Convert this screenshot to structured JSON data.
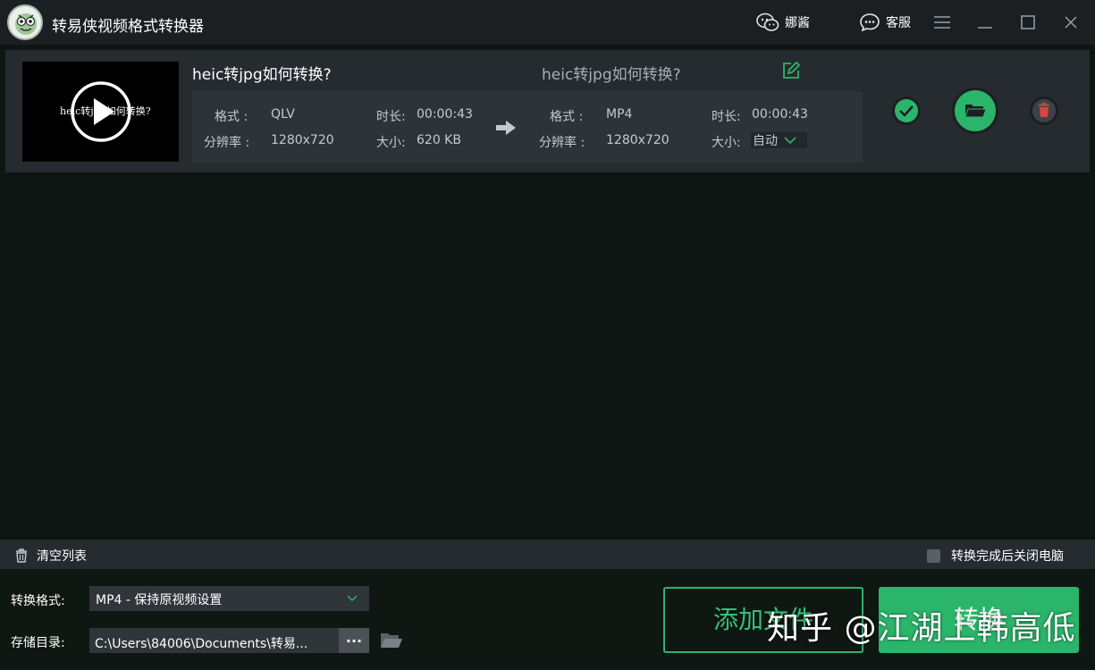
{
  "app": {
    "title": "转易侠视频格式转换器"
  },
  "titlebar": {
    "user_label": "娜酱",
    "service_label": "客服"
  },
  "file": {
    "source_name": "heic转jpg如何转换?",
    "output_name": "heic转jpg如何转换?",
    "thumbnail_text": "heic转jpg如何转换?",
    "source": {
      "format_label": "格式   :",
      "format": "QLV",
      "resolution_label": "分辨率   :",
      "resolution": "1280x720",
      "duration_label": "时长:",
      "duration": "00:00:43",
      "size_label": "大小:",
      "size": "620 KB"
    },
    "target": {
      "format_label": "格式   :",
      "format": "MP4",
      "resolution_label": "分辨率   :",
      "resolution": "1280x720",
      "duration_label": "时长:",
      "duration": "00:00:43",
      "size_label": "大小:",
      "size": "自动"
    }
  },
  "list_bar": {
    "clear_label": "清空列表",
    "shutdown_label": "转换完成后关闭电脑"
  },
  "bottom": {
    "format_label": "转换格式:",
    "format_value": "MP4 - 保持原视频设置",
    "dir_label": "存储目录:",
    "dir_value": "C:\\Users\\84006\\Documents\\转易...",
    "browse_label": "...",
    "add_file_label": "添加文件",
    "convert_label": "转换"
  },
  "watermark": "知乎 @江湖上韩高低",
  "colors": {
    "accent": "#2bb56b",
    "background": "#0e1512",
    "card": "#262b30",
    "danger": "#d94545"
  },
  "icons": [
    "logo",
    "wechat-icon",
    "chat-icon",
    "menu-icon",
    "minimize-icon",
    "maximize-icon",
    "close-icon",
    "play-icon",
    "edit-icon",
    "arrow-right-icon",
    "chevron-down-icon",
    "check-icon",
    "folder-icon",
    "trash-icon"
  ]
}
